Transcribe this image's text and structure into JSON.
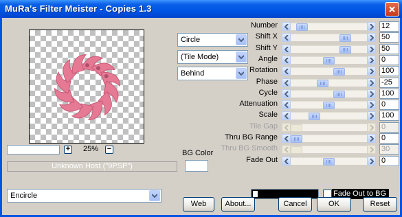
{
  "window": {
    "title": "MuRa's Filter Meister - Copies 1.3"
  },
  "preview": {
    "zoom_value": "25%",
    "host_text": "Unknown Host (\"9PSP\")"
  },
  "selects": {
    "shape": "Circle",
    "mode": "(Tile Mode)",
    "order": "Behind",
    "bottom": "Encircle"
  },
  "bg_color_label": "BG Color",
  "params": [
    {
      "label": "Number",
      "value": "12",
      "level": 0.08,
      "enabled": true
    },
    {
      "label": "Shift X",
      "value": "50",
      "level": 0.75,
      "enabled": true
    },
    {
      "label": "Shift Y",
      "value": "50",
      "level": 0.75,
      "enabled": true
    },
    {
      "label": "Angle",
      "value": "0",
      "level": 0.5,
      "enabled": true
    },
    {
      "label": "Rotation",
      "value": "100",
      "level": 0.66,
      "enabled": true
    },
    {
      "label": "Phase",
      "value": "-25",
      "level": 0.4,
      "enabled": true
    },
    {
      "label": "Cycle",
      "value": "100",
      "level": 0.66,
      "enabled": true
    },
    {
      "label": "Attenuation",
      "value": "0",
      "level": 0.5,
      "enabled": true
    },
    {
      "label": "Scale",
      "value": "100",
      "level": 0.28,
      "enabled": true
    },
    {
      "label": "Tile Gap",
      "value": "0",
      "level": 0.0,
      "enabled": false
    },
    {
      "label": "Thru BG Range",
      "value": "0",
      "level": 0.0,
      "enabled": true
    },
    {
      "label": "Thru BG Smooth",
      "value": "30",
      "level": 0.0,
      "enabled": false
    },
    {
      "label": "Fade Out",
      "value": "0",
      "level": 0.5,
      "enabled": true
    }
  ],
  "fade_out_to_bg_label": "Fade Out to BG",
  "buttons": {
    "web": "Web",
    "about": "About...",
    "cancel": "Cancel",
    "ok": "OK",
    "reset": "Reset"
  },
  "colors": {
    "title_bar": "#0055e5",
    "petal": "#e67a95",
    "bg": "#d4d0c8"
  }
}
